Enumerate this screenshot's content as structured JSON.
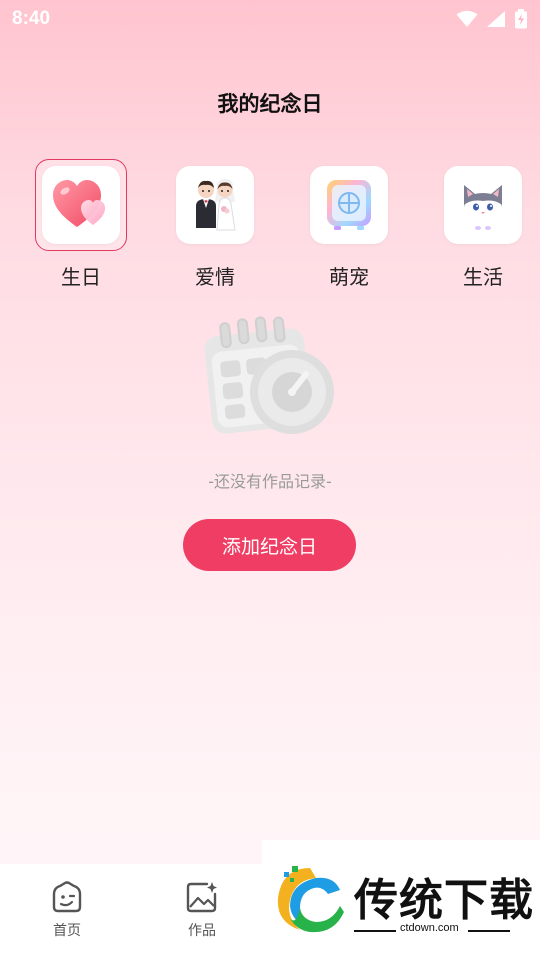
{
  "status_bar": {
    "time": "8:40"
  },
  "header": {
    "title": "我的纪念日"
  },
  "categories": [
    {
      "label": "生日",
      "icon": "heart-icon",
      "selected": true
    },
    {
      "label": "爱情",
      "icon": "couple-icon",
      "selected": false
    },
    {
      "label": "萌宠",
      "icon": "pet-safe-icon",
      "selected": false
    },
    {
      "label": "生活",
      "icon": "cat-icon",
      "selected": false
    }
  ],
  "empty_state": {
    "icon": "calendar-clock-icon",
    "text": "-还没有作品记录-"
  },
  "actions": {
    "add_label": "添加纪念日"
  },
  "bottom_nav": {
    "items": [
      {
        "label": "首页",
        "icon": "home-icon"
      },
      {
        "label": "作品",
        "icon": "gallery-icon"
      }
    ]
  },
  "watermark": {
    "text": "传统下载",
    "url": "ctdown.com"
  },
  "colors": {
    "accent": "#ef3d64",
    "selected_border": "#e03a5e"
  }
}
